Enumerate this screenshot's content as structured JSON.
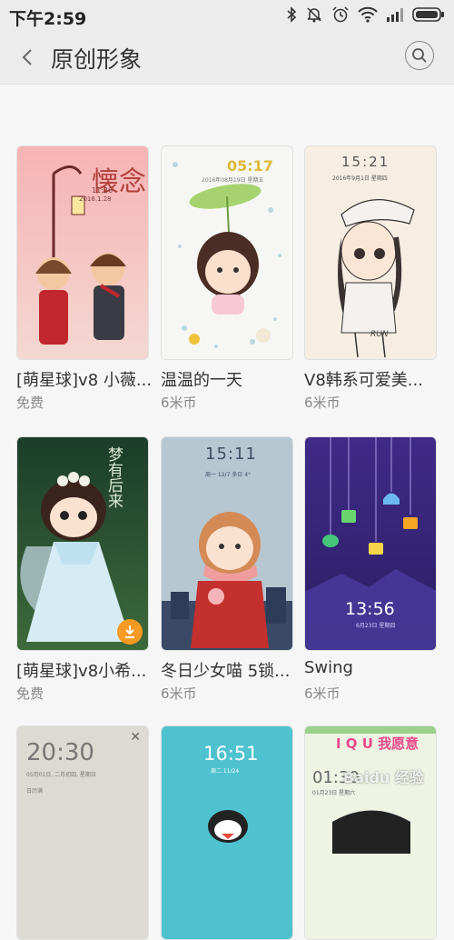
{
  "status": {
    "time": "下午2:59"
  },
  "header": {
    "title": "原创形象"
  },
  "items": [
    {
      "name": "[萌星球]v8 小薇...",
      "price": "免费",
      "thumb_time": "11:26",
      "thumb_title": "懐念",
      "thumb_date": "2016.1.28"
    },
    {
      "name": "温温的一天",
      "price": "6米币",
      "thumb_time": "05:17",
      "thumb_date": "2016年08月19日 星期五"
    },
    {
      "name": "V8韩系可爱美...",
      "price": "6米币",
      "thumb_time": "15:21",
      "thumb_date": "2016年9月1日  星期四",
      "thumb_caption": "RUN"
    },
    {
      "name": "[萌星球]v8小希...",
      "price": "免费",
      "thumb_title": "梦有后来"
    },
    {
      "name": "冬日少女喵 5锁...",
      "price": "6米币",
      "thumb_time": "15:11",
      "thumb_date": "周一 12/7 多日 4°"
    },
    {
      "name": "Swing",
      "price": "6米币",
      "thumb_time": "13:56",
      "thumb_date": "6月23日 星期四"
    },
    {
      "name": "",
      "price": "",
      "thumb_time": "20:30",
      "thumb_date": "05月01日, 二月初四, 星期日",
      "thumb_caption": "日历满"
    },
    {
      "name": "",
      "price": "",
      "thumb_time": "16:51",
      "thumb_date": "周二 11/24"
    },
    {
      "name": "",
      "price": "",
      "thumb_title": "I Q U 我愿意",
      "thumb_time": "01:30",
      "thumb_date": "01月23日 星期六"
    }
  ],
  "watermark": "Baidu 经验",
  "colors": {
    "accent": "#f59a23",
    "header_bg": "#ececec"
  }
}
